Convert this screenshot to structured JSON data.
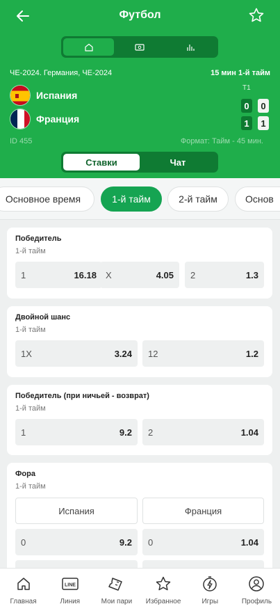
{
  "header": {
    "title": "Футбол",
    "event_league": "ЧЕ-2024. Германия, ЧЕ-2024",
    "match_status": "15 мин 1-й тайм",
    "period_col": "T1",
    "team_home": "Испания",
    "team_away": "Франция",
    "score_home": [
      "0",
      "0"
    ],
    "score_away": [
      "1",
      "1"
    ],
    "event_id": "ID 455",
    "format": "Формат: Тайм - 45 мин.",
    "tabs": [
      "Ставки",
      "Чат"
    ],
    "colors": {
      "brand": "#1fae4b",
      "dark": "#0f7b33"
    }
  },
  "periods": [
    "Основное время",
    "1-й тайм",
    "2-й тайм",
    "Основ"
  ],
  "markets": {
    "winner": {
      "title": "Победитель",
      "subtitle": "1-й тайм",
      "odds": [
        {
          "label": "1",
          "value": "16.18"
        },
        {
          "label": "X",
          "value": "4.05"
        },
        {
          "label": "2",
          "value": "1.3"
        }
      ]
    },
    "double_chance": {
      "title": "Двойной шанс",
      "subtitle": "1-й тайм",
      "odds": [
        {
          "label": "1X",
          "value": "3.24"
        },
        {
          "label": "12",
          "value": "1.2"
        }
      ]
    },
    "dnb": {
      "title": "Победитель (при ничьей - возврат)",
      "subtitle": "1-й тайм",
      "odds": [
        {
          "label": "1",
          "value": "9.2"
        },
        {
          "label": "2",
          "value": "1.04"
        }
      ]
    },
    "handicap": {
      "title": "Фора",
      "subtitle": "1-й тайм",
      "teams": [
        "Испания",
        "Франция"
      ],
      "odds": [
        {
          "label": "0",
          "value": "9.2"
        },
        {
          "label": "0",
          "value": "1.04"
        }
      ]
    }
  },
  "nav": {
    "items": [
      "Главная",
      "Линия",
      "Мои пари",
      "Избранное",
      "Игры",
      "Профиль"
    ],
    "line_icon_text": "LINE"
  }
}
